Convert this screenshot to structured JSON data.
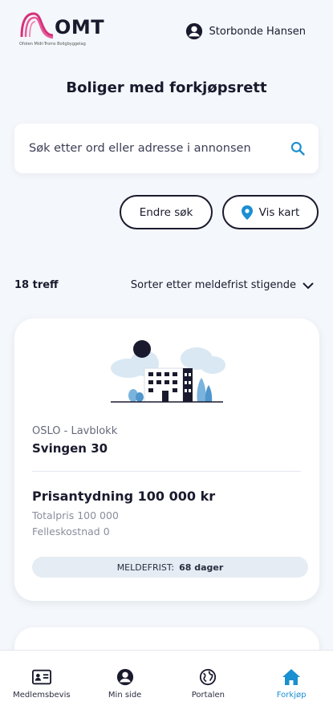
{
  "header": {
    "logo_text": "OMT",
    "logo_subtitle": "Ofoten Midt-Troms Boligbyggelag",
    "user_name": "Storbonde Hansen",
    "user_icon": "user-circle-icon"
  },
  "page": {
    "title": "Boliger med forkjøpsrett"
  },
  "search": {
    "placeholder": "Søk etter ord eller adresse i annonsen",
    "value": "",
    "icon": "search-icon"
  },
  "actions": {
    "edit_search_label": "Endre søk",
    "show_map_label": "Vis kart",
    "map_icon": "location-pin-icon"
  },
  "results": {
    "count_label": "18 treff",
    "sort_label": "Sorter etter meldefrist stigende"
  },
  "listings": [
    {
      "type_label": "OSLO - Lavblokk",
      "address": "Svingen 30",
      "price_label": "Prisantydning 100 000 kr",
      "total_label": "Totalpris 100 000",
      "felles_label": "Felleskostnad 0",
      "deadline_label": "MELDEFRIST:",
      "deadline_value": "68 dager"
    }
  ],
  "nav": {
    "items": [
      {
        "label": "Medlemsbevis",
        "icon": "id-card-icon",
        "active": false
      },
      {
        "label": "Min side",
        "icon": "user-circle-icon",
        "active": false
      },
      {
        "label": "Portalen",
        "icon": "globe-icon",
        "active": false
      },
      {
        "label": "Forkjøp",
        "icon": "home-icon",
        "active": true
      }
    ]
  },
  "colors": {
    "accent": "#1a8fd1",
    "brand_pink": "#d6307a",
    "text": "#1a1a2e",
    "background": "#f4f7fb"
  }
}
